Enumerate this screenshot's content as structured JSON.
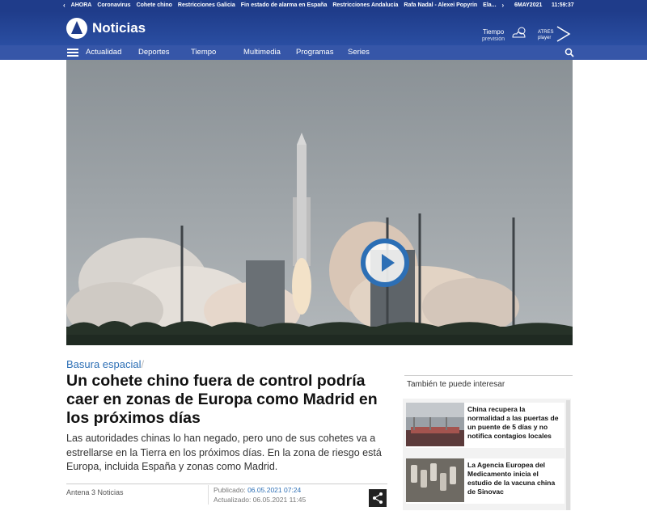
{
  "ticker": {
    "label": "AHORA",
    "items": [
      "Coronavirus",
      "Cohete chino",
      "Restricciones Galicia",
      "Fin estado de alarma en España",
      "Restricciones Andalucía",
      "Rafa Nadal - Alexei Popyrin",
      "Ela..."
    ],
    "date": "6MAY2021",
    "time": "11:59:37"
  },
  "header": {
    "brand": "Noticias",
    "weather_label": "Tiempo",
    "weather_sub": "previsión",
    "atres_label_1": "ATRES",
    "atres_label_2": "player"
  },
  "nav": {
    "items": [
      "Actualidad",
      "Deportes",
      "Tiempo",
      "Multimedia",
      "Programas",
      "Series"
    ]
  },
  "article": {
    "section": "Basura espacial",
    "section_sep": "/",
    "headline": "Un cohete chino fuera de control podría caer en zonas de Europa como Madrid en los próximos días",
    "lead": "Las autoridades chinas lo han negado, pero uno de sus cohetes va a estrellarse en la Tierra en los próximos días. En la zona de riesgo está Europa, incluida España y zonas como Madrid.",
    "source": "Antena 3 Noticias",
    "published_label": "Publicado:",
    "published_value": "06.05.2021 07:24",
    "updated_label": "Actualizado:",
    "updated_value": "06.05.2021 11:45"
  },
  "sidebar": {
    "title": "También te puede interesar",
    "cards": [
      {
        "title": "China recupera la normalidad a las puertas de un puente de 5 días y no notifica contagios locales"
      },
      {
        "title": "La Agencia Europea del Medicamento inicia el estudio de la vacuna china de Sinovac"
      }
    ]
  },
  "colors": {
    "brand_blue": "#1f3c8a",
    "nav_blue": "#3656a8",
    "link_blue": "#2d6fb5"
  }
}
